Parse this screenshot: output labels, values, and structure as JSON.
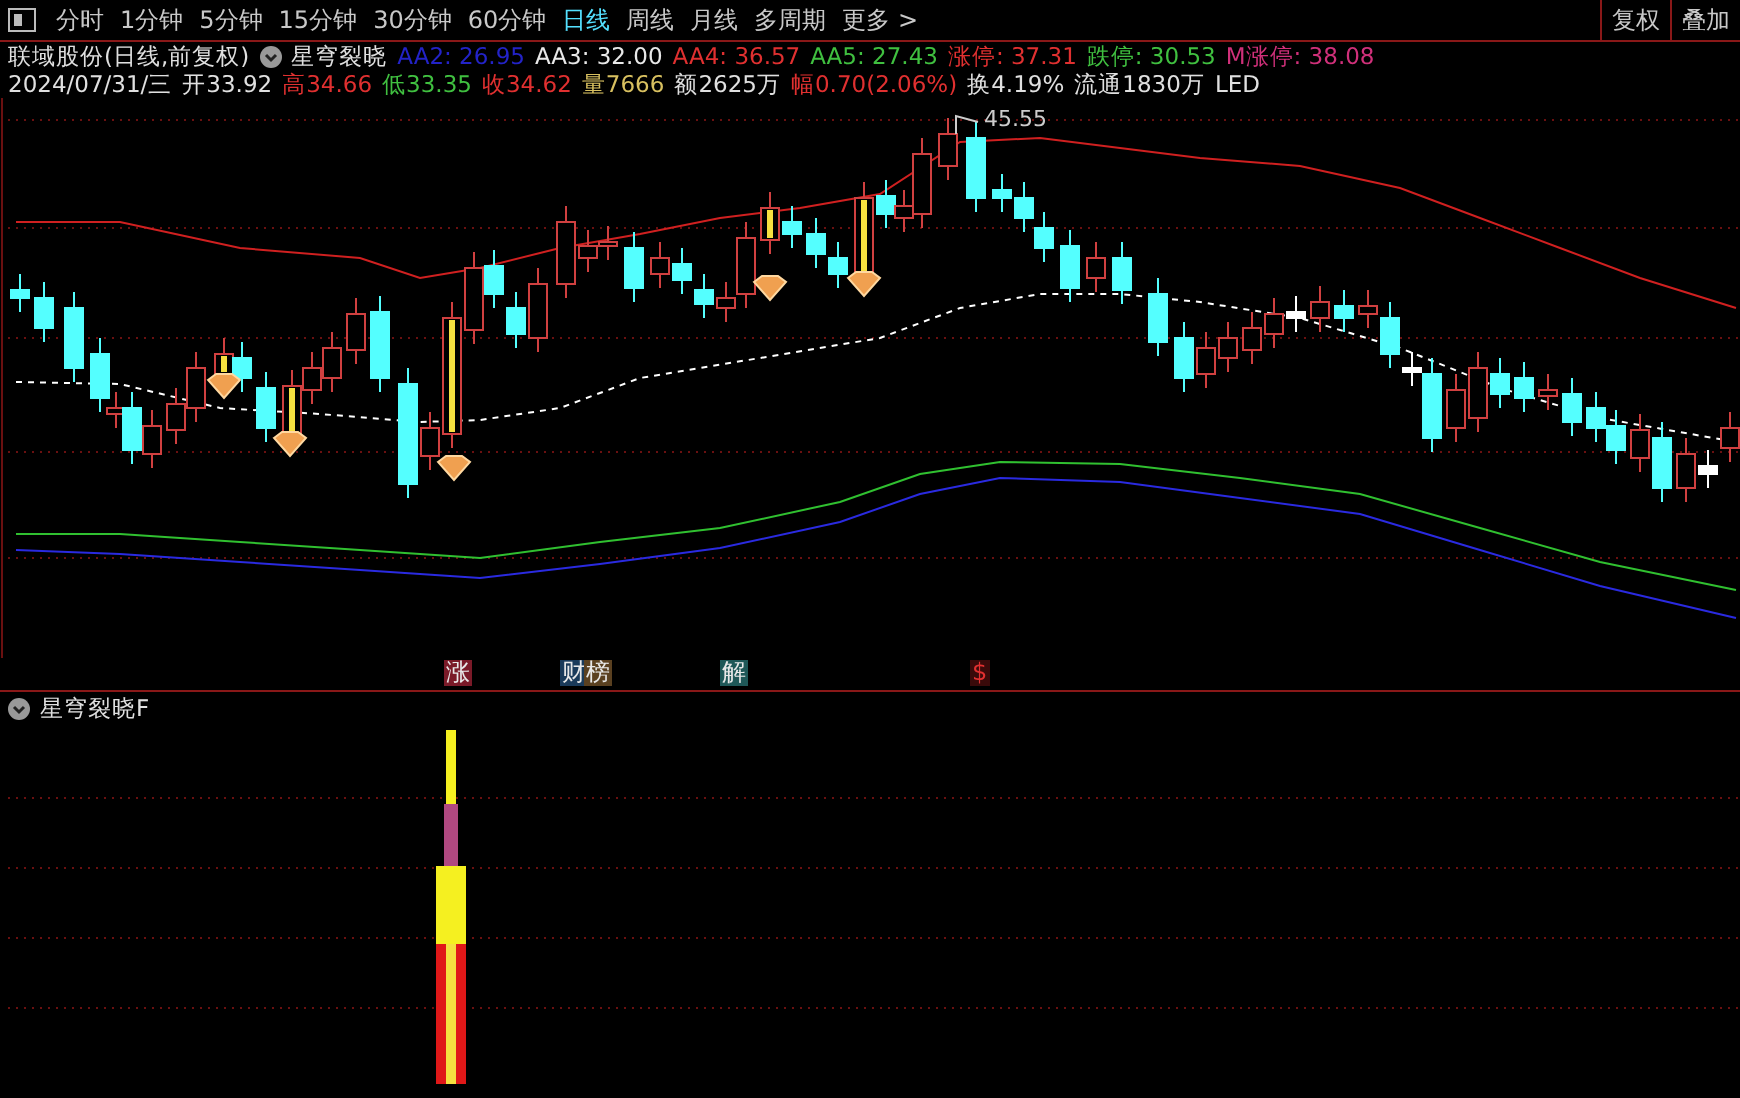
{
  "toolbar": {
    "periods": [
      {
        "label": "分时",
        "selected": false
      },
      {
        "label": "1分钟",
        "selected": false
      },
      {
        "label": "5分钟",
        "selected": false
      },
      {
        "label": "15分钟",
        "selected": false
      },
      {
        "label": "30分钟",
        "selected": false
      },
      {
        "label": "60分钟",
        "selected": false
      },
      {
        "label": "日线",
        "selected": true
      },
      {
        "label": "周线",
        "selected": false
      },
      {
        "label": "月线",
        "selected": false
      },
      {
        "label": "多周期",
        "selected": false
      }
    ],
    "more": "更多 >",
    "buttons": [
      "复权",
      "叠加"
    ]
  },
  "info": {
    "title": "联域股份(日线,前复权)",
    "indicator": "星穹裂晓",
    "values": [
      {
        "text": "AA2: 26.95",
        "color": "#2323c8"
      },
      {
        "text": "AA3: 32.00",
        "color": "#e8e8e8"
      },
      {
        "text": "AA4: 36.57",
        "color": "#e03030"
      },
      {
        "text": "AA5: 27.43",
        "color": "#40c040"
      },
      {
        "text": "涨停: 37.31",
        "color": "#e03030"
      },
      {
        "text": "跌停: 30.53",
        "color": "#40c040"
      },
      {
        "text": "M涨停: 38.08",
        "color": "#d0307a"
      }
    ]
  },
  "quote": [
    {
      "text": "2024/07/31/三",
      "color": "#e0e0e0"
    },
    {
      "text": "开33.92",
      "color": "#e0e0e0"
    },
    {
      "text": "高34.66",
      "color": "#e03030"
    },
    {
      "text": "低33.35",
      "color": "#40c040"
    },
    {
      "text": "收34.62",
      "color": "#e03030"
    },
    {
      "text": "量7666",
      "color": "#d8c060"
    },
    {
      "text": "额2625万",
      "color": "#e0e0e0"
    },
    {
      "text": "幅0.70(2.06%)",
      "color": "#e03030"
    },
    {
      "text": "换4.19%",
      "color": "#e0e0e0"
    },
    {
      "text": "流通1830万",
      "color": "#e0e0e0"
    },
    {
      "text": "LED",
      "color": "#e0e0e0"
    }
  ],
  "chart": {
    "peak_label": "45.55"
  },
  "markers": [
    {
      "text": "涨",
      "color": "#7a1a28"
    },
    {
      "text": "财",
      "color": "#1a3a5a"
    },
    {
      "text": "榜",
      "color": "#5a4020"
    },
    {
      "text": "解",
      "color": "#1f5858"
    },
    {
      "text": "$",
      "color": "#3a0a0a"
    }
  ],
  "lower_panel": {
    "title": "星穹裂晓F"
  }
}
